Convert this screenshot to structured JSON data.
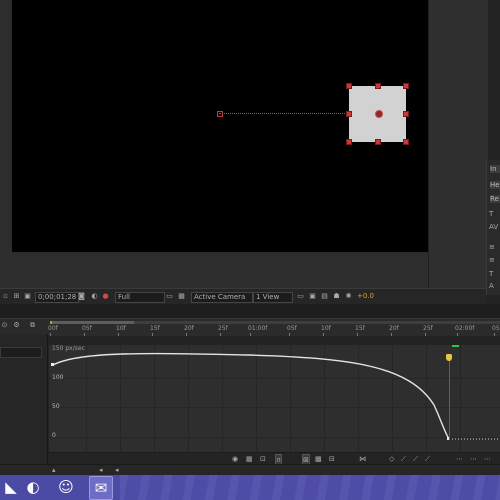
{
  "viewer_toolbar": {
    "timecode": "0;00;01;28",
    "resolution": "Full",
    "camera": "Active Camera",
    "view_layout": "1 View",
    "exposure": "+0.0"
  },
  "timeline": {
    "ruler_labels": [
      "00f",
      "05f",
      "10f",
      "15f",
      "20f",
      "25f",
      "01:00f",
      "05f",
      "10f",
      "15f",
      "20f",
      "25f",
      "02:00f",
      "05"
    ],
    "graph_title": "150 px/sec",
    "y_labels": [
      "100",
      "50",
      "0"
    ]
  },
  "right_panel": {
    "labels": [
      "In",
      "He",
      "Re"
    ],
    "icons": [
      "T",
      "AV",
      "≡",
      "≡",
      "T",
      "A"
    ]
  },
  "icons": {
    "snapshot": "camera-icon",
    "channels": "rgb-channels-icon",
    "fast_previews": "lightning-icon",
    "taskbar": [
      "start-icon",
      "media-player-icon",
      "messenger-icon",
      "chat-icon"
    ]
  },
  "colors": {
    "motion_path": "#c04040",
    "current_time_indicator": "#d03030",
    "work_area": "#c8962a"
  }
}
